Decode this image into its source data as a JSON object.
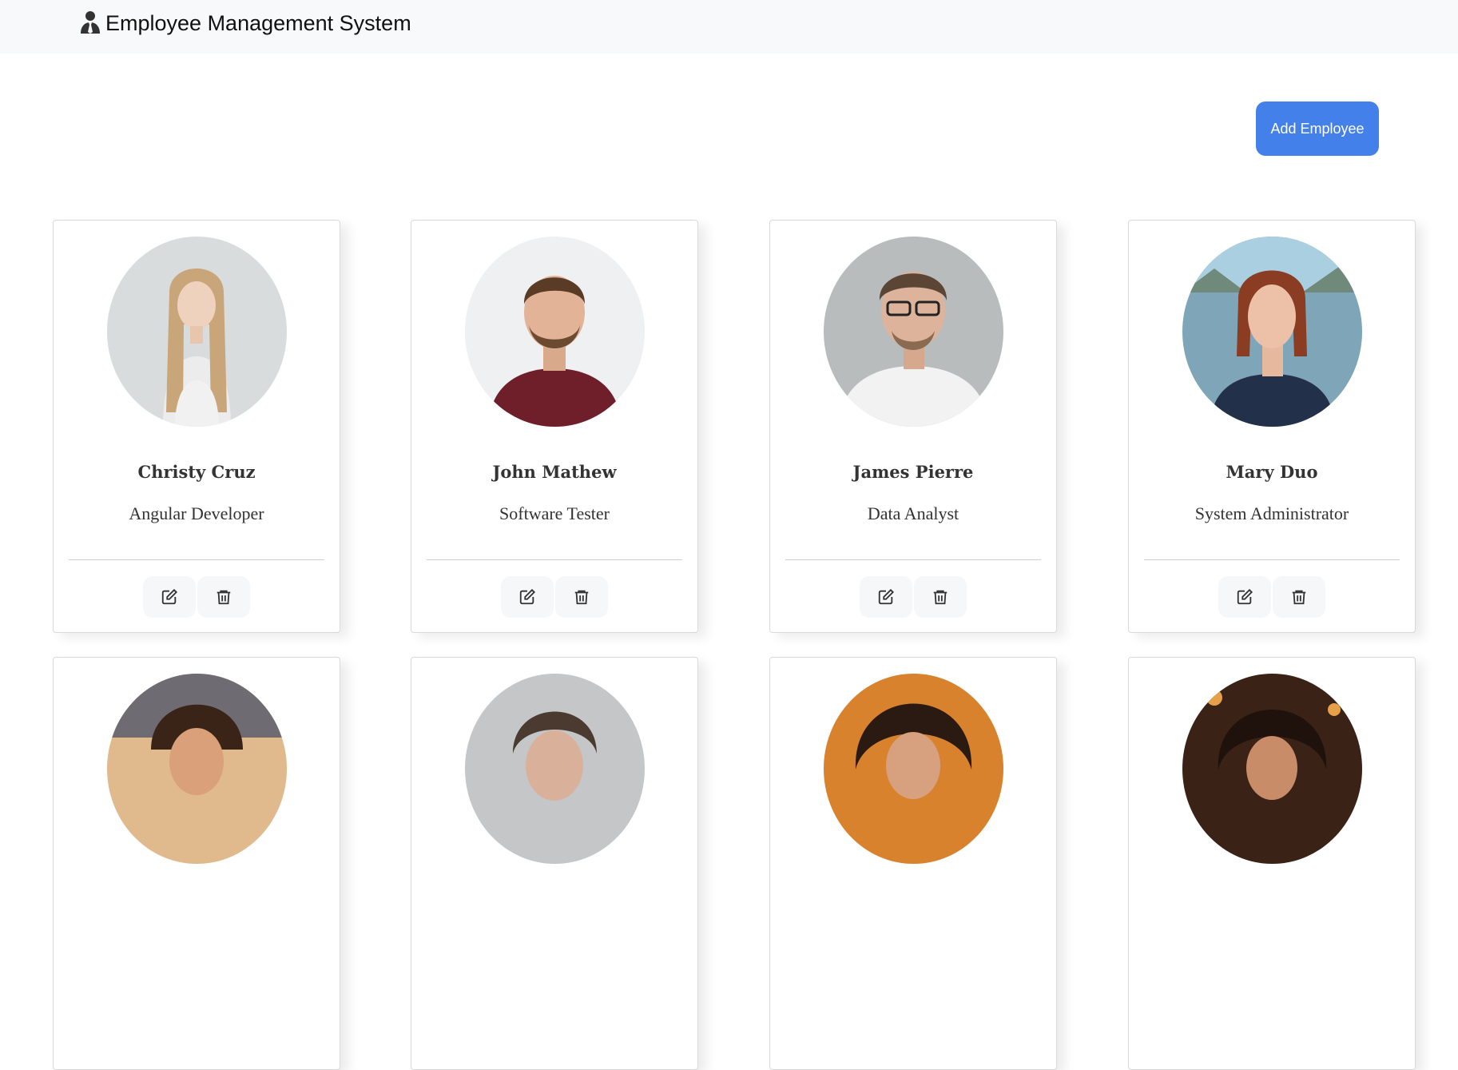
{
  "header": {
    "brand_icon": "person-tie-icon",
    "title": "Employee Management System"
  },
  "toolbar": {
    "add_label": "Add Employee",
    "accent": "#4380e9"
  },
  "employees": [
    {
      "name": "Christy Cruz",
      "role": "Angular Developer"
    },
    {
      "name": "John Mathew",
      "role": "Software Tester"
    },
    {
      "name": "James Pierre",
      "role": "Data Analyst"
    },
    {
      "name": "Mary Duo",
      "role": "System Administrator"
    },
    {
      "name": "",
      "role": ""
    },
    {
      "name": "",
      "role": ""
    },
    {
      "name": "",
      "role": ""
    },
    {
      "name": "",
      "role": ""
    }
  ],
  "card_actions": {
    "edit_icon": "edit-icon",
    "delete_icon": "trash-icon"
  }
}
